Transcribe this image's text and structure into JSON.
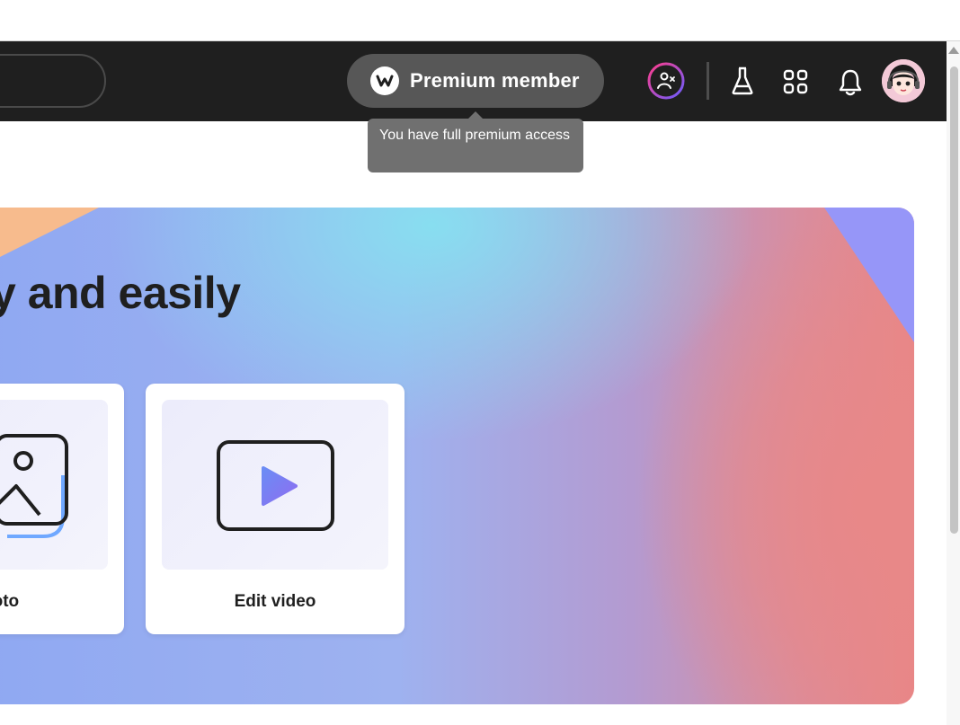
{
  "header": {
    "premium_label": "Premium member",
    "tooltip_text": "You have full premium access"
  },
  "hero": {
    "title": "y and easily",
    "cards": [
      {
        "label": "hoto",
        "icon": "image-icon"
      },
      {
        "label": "Edit video",
        "icon": "video-play-icon"
      }
    ]
  },
  "icons": [
    "premium-badge-icon",
    "community-icon",
    "labs-flask-icon",
    "apps-grid-icon",
    "notification-bell-icon",
    "user-avatar"
  ],
  "colors": {
    "topbar": "#1f1f1f",
    "pill": "#575757",
    "tooltip": "#707070",
    "accent_play": "#7b6ff0"
  }
}
